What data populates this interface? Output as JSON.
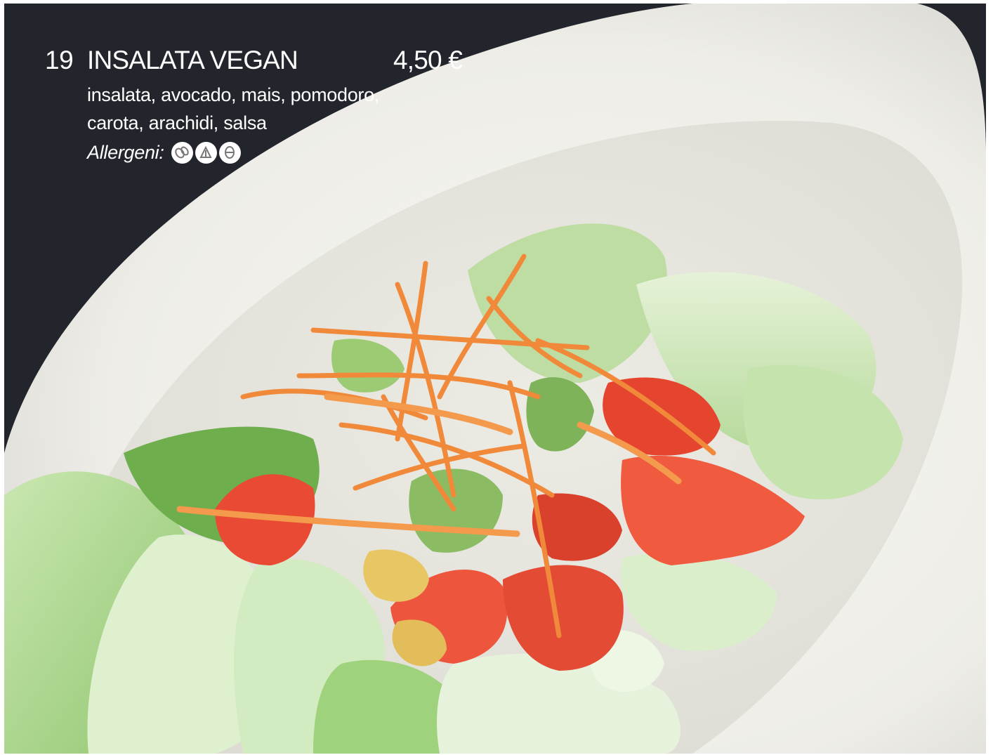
{
  "menu_item": {
    "number": "19",
    "name": "INSALATA VEGAN",
    "price": "4,50 €",
    "description_lines": [
      "insalata, avocado, mais, pomodoro,",
      "carota, arachidi, salsa"
    ],
    "allergens_label": "Allergeni:",
    "allergen_icons": [
      "peanut-icon",
      "celery-icon",
      "sesame-icon"
    ]
  },
  "colors": {
    "background": "#23252c",
    "bowl": "#f1f0ea",
    "text": "#ffffff"
  }
}
